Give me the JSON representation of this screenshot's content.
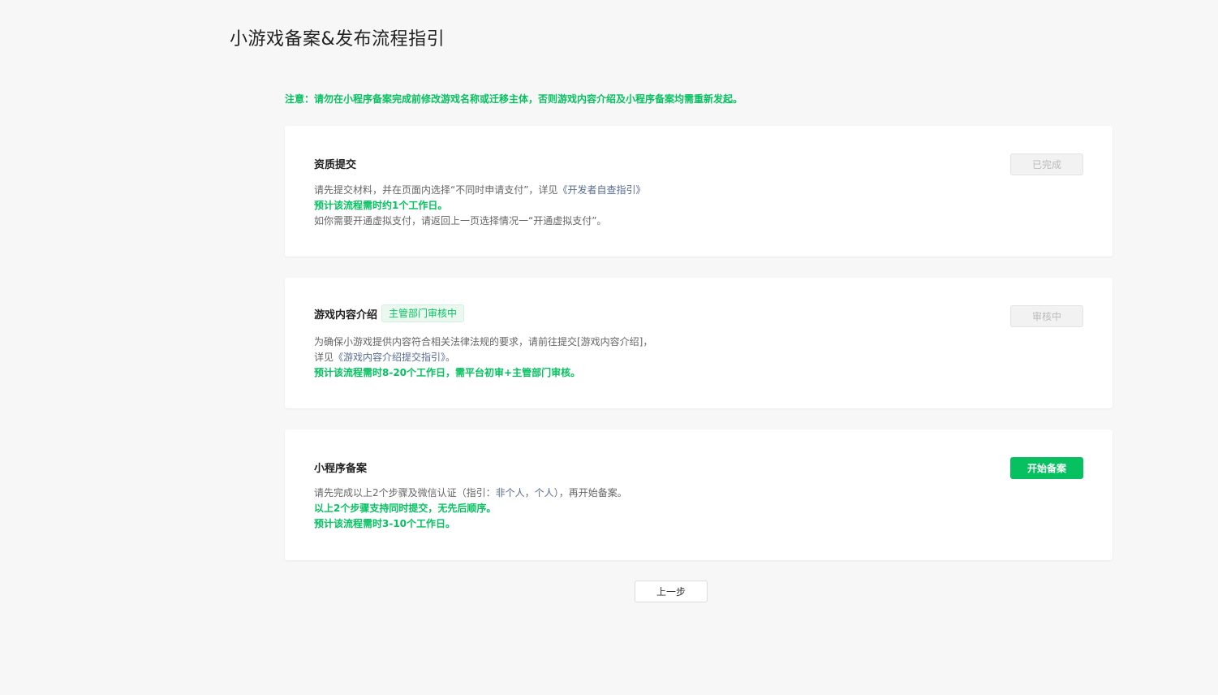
{
  "page": {
    "title": "小游戏备案&发布流程指引",
    "notice": "注意：请勿在小程序备案完成前修改游戏名称或迁移主体，否则游戏内容介绍及小程序备案均需重新发起。"
  },
  "colors": {
    "accent": "#07c160",
    "link": "#576b95",
    "background": "#f7f7f7"
  },
  "cards": [
    {
      "title": "资质提交",
      "button": "已完成",
      "desc_1_a": "请先提交材料，并在页面内选择“不同时申请支付”，详见",
      "desc_1_link": "《开发者自查指引》",
      "desc_2": "预计该流程需时约1个工作日。",
      "desc_3": "如你需要开通虚拟支付，请返回上一页选择情况一“开通虚拟支付”。"
    },
    {
      "title": "游戏内容介绍",
      "tag": "主管部门审核中",
      "button": "审核中",
      "desc_1": "为确保小游戏提供内容符合相关法律法规的要求，请前往提交[游戏内容介绍]，",
      "desc_2_a": "详见",
      "desc_2_link": "《游戏内容介绍提交指引》",
      "desc_2_b": "。",
      "desc_3": "预计该流程需时8-20个工作日，需平台初审+主管部门审核。"
    },
    {
      "title": "小程序备案",
      "button": "开始备案",
      "desc_1_a": "请先完成以上2个步骤及微信认证（指引：",
      "desc_1_link1": "非个人",
      "desc_1_sep": "，",
      "desc_1_link2": "个人",
      "desc_1_b": "），再开始备案。",
      "desc_2": "以上2个步骤支持同时提交，无先后顺序。",
      "desc_3": "预计该流程需时3-10个工作日。"
    }
  ],
  "footer": {
    "back_button": "上一步"
  }
}
